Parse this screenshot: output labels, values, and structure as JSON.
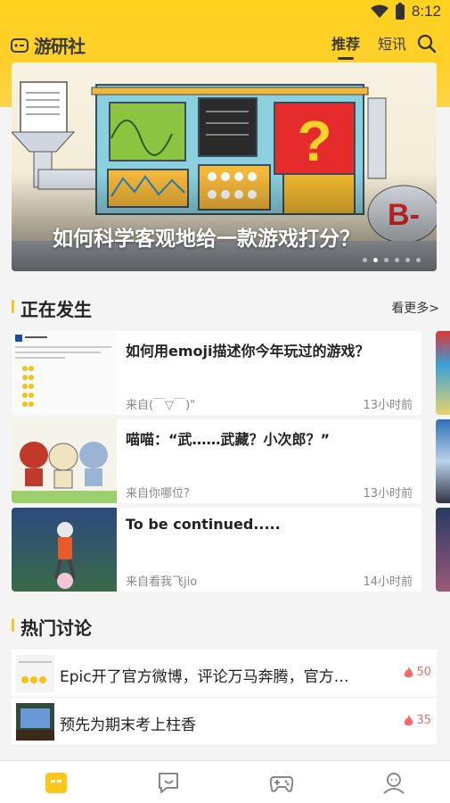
{
  "status_bar": {
    "time": "8:12"
  },
  "header": {
    "logo_text": "游研社",
    "tabs": [
      {
        "label": "推荐",
        "active": true
      },
      {
        "label": "短讯",
        "active": false
      }
    ],
    "icons": {
      "search": "search-icon",
      "logo": "gamepad-logo-icon"
    }
  },
  "banner": {
    "title": "如何科学客观地给一款游戏打分？",
    "dots": 6,
    "active_dot": 1
  },
  "happening": {
    "title": "正在发生",
    "more": "看更多>",
    "cards": [
      {
        "title": "如何用emoji描述你今年玩过的游戏？",
        "source": "来自(￣▽￣)\"",
        "time": "13小时前"
      },
      {
        "title": "喵喵：“武……武藏？小次郎？”",
        "source": "来自你哪位?",
        "time": "13小时前"
      },
      {
        "title": "To be continued.....",
        "source": "来自看我飞jio",
        "time": "14小时前"
      }
    ]
  },
  "hot": {
    "title": "热门讨论",
    "items": [
      {
        "title": "Epic开了官方微博，评论万马奔腾，官方回复...",
        "count": "50"
      },
      {
        "title": "预先为期末考上柱香",
        "count": "35"
      }
    ]
  },
  "bottom_nav": [
    {
      "name": "home-tab",
      "icon": "home-icon"
    },
    {
      "name": "chat-tab",
      "icon": "chat-icon"
    },
    {
      "name": "games-tab",
      "icon": "gamepad-icon"
    },
    {
      "name": "profile-tab",
      "icon": "user-icon"
    }
  ],
  "colors": {
    "accent": "#ffd21f",
    "hot": "#f36b6b"
  }
}
